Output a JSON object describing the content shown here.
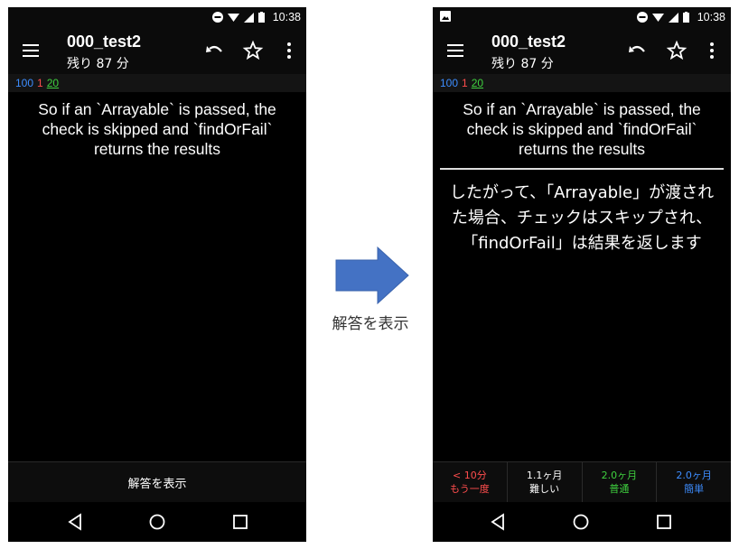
{
  "left_screen": {
    "status": {
      "time": "10:38"
    },
    "appbar": {
      "title": "000_test2",
      "subtitle": "残り 87 分"
    },
    "counts": {
      "new": "100",
      "learn": "1",
      "review": "20"
    },
    "question": "So if an `Arrayable` is passed, the check is skipped and `findOrFail` returns the results",
    "show_answer_label": "解答を表示"
  },
  "right_screen": {
    "status": {
      "time": "10:38"
    },
    "appbar": {
      "title": "000_test2",
      "subtitle": "残り 87 分"
    },
    "counts": {
      "new": "100",
      "learn": "1",
      "review": "20"
    },
    "question": "So if an `Arrayable` is passed, the check is skipped and `findOrFail` returns the results",
    "answer": "したがって、「Arrayable」が渡された場合、チェックはスキップされ、「findOrFail」は結果を返します",
    "ease_buttons": [
      {
        "interval": "< 10分",
        "label": "もう一度",
        "color": "#ff4d4d"
      },
      {
        "interval": "1.1ヶ月",
        "label": "難しい",
        "color": "#ffffff"
      },
      {
        "interval": "2.0ヶ月",
        "label": "普通",
        "color": "#3fd13f"
      },
      {
        "interval": "2.0ヶ月",
        "label": "簡単",
        "color": "#3d8dff"
      }
    ]
  },
  "transition": {
    "label": "解答を表示",
    "arrow_color": "#4472c4"
  },
  "icons": {
    "menu": "menu-icon",
    "undo": "undo-icon",
    "star": "star-outline-icon",
    "more": "more-vert-icon",
    "nav_back": "triangle-back-icon",
    "nav_home": "circle-home-icon",
    "nav_recents": "square-recents-icon"
  }
}
